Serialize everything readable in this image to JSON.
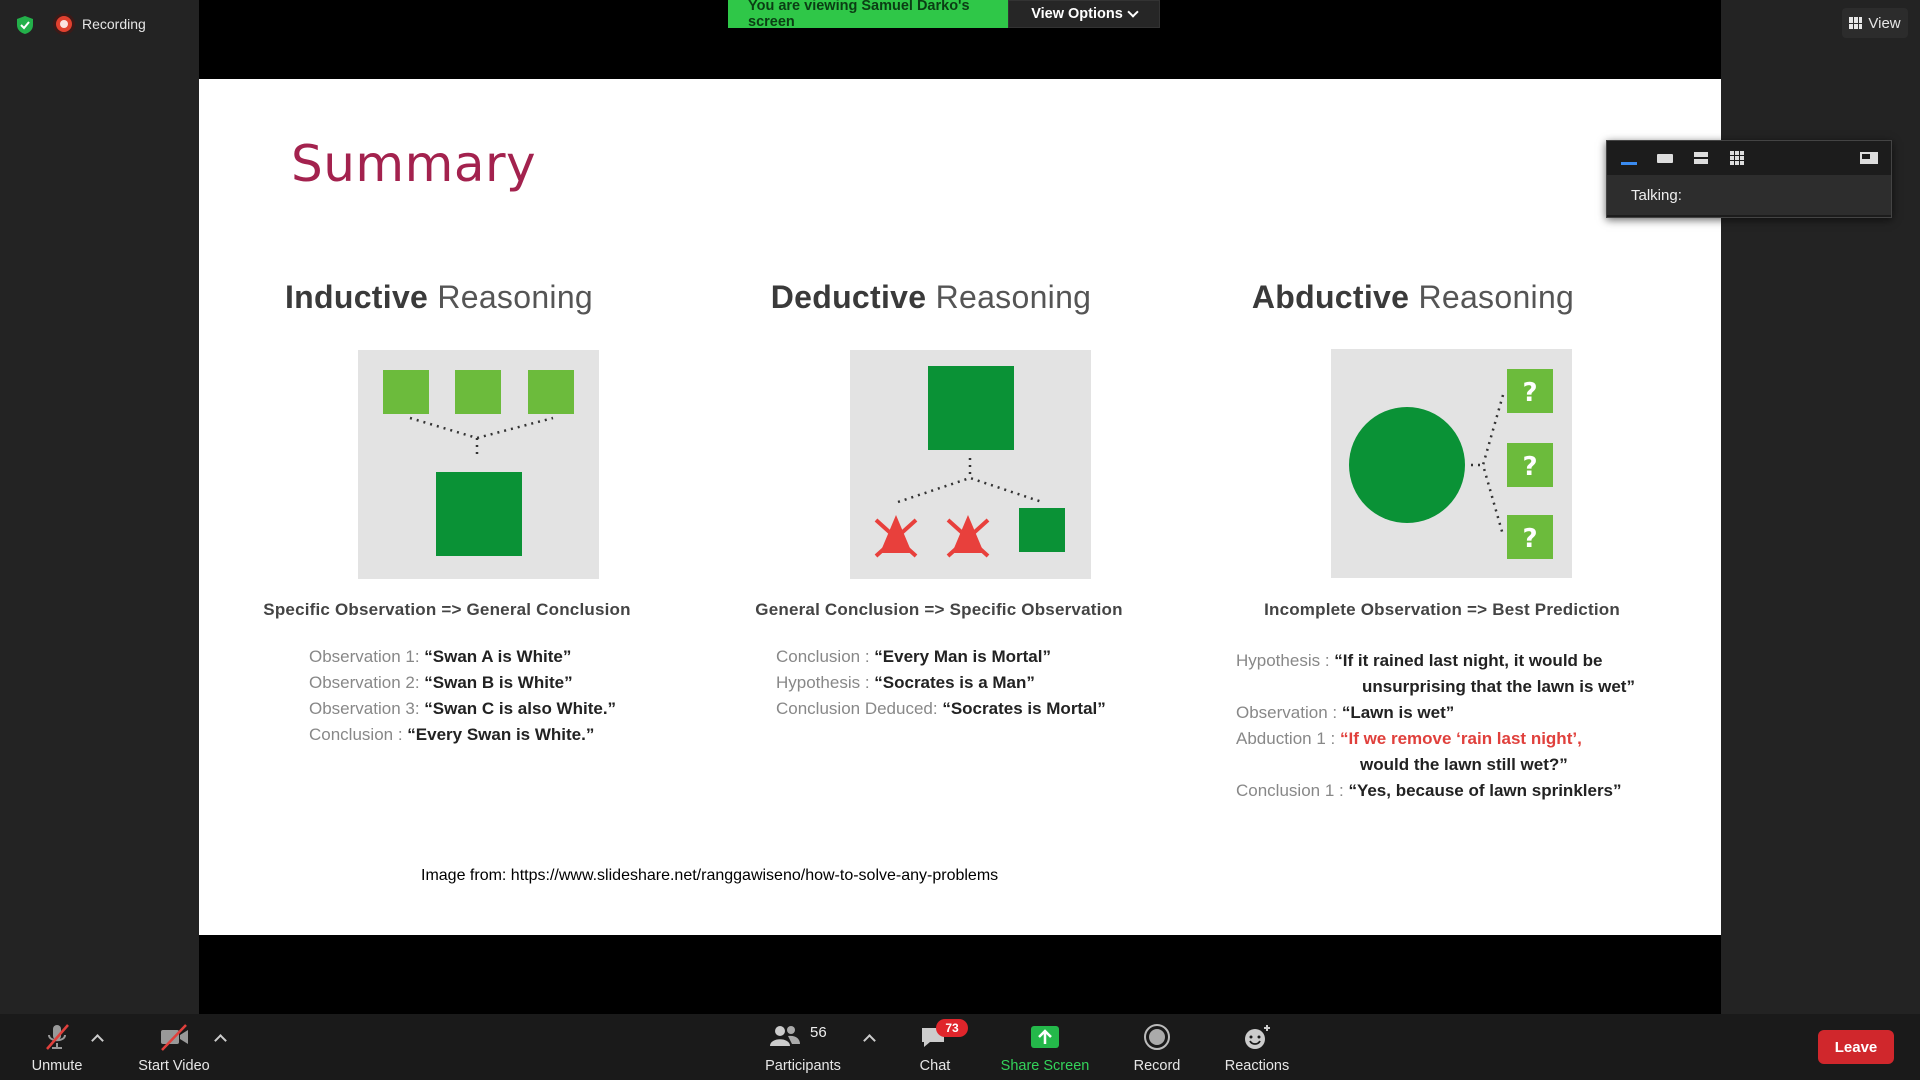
{
  "meeting": {
    "recording_label": "Recording",
    "view_label": "View",
    "banner_text": "You are viewing Samuel Darko's screen",
    "view_options_label": "View Options",
    "talking_label": "Talking:"
  },
  "slide": {
    "title": "Summary",
    "credit": "Image from: https://www.slideshare.net/ranggawiseno/how-to-solve-any-problems",
    "columns": [
      {
        "title_bold": "Inductive",
        "title_rest": " Reasoning",
        "caption": "Specific Observation => General Conclusion",
        "lines": [
          {
            "label": "Observation 1: ",
            "value": "“Swan A is White”"
          },
          {
            "label": "Observation 2: ",
            "value": "“Swan B is White”"
          },
          {
            "label": "Observation 3: ",
            "value": "“Swan C is also White.”"
          },
          {
            "label": "Conclusion      : ",
            "value": "“Every Swan is White.”"
          }
        ]
      },
      {
        "title_bold": "Deductive",
        "title_rest": " Reasoning",
        "caption": "General Conclusion => Specific Observation",
        "lines": [
          {
            "label": "Conclusion               : ",
            "value": "“Every Man is Mortal”"
          },
          {
            "label": "Hypothesis               : ",
            "value": "“Socrates is a Man”"
          },
          {
            "label": "Conclusion Deduced: ",
            "value": "“Socrates is Mortal”"
          }
        ]
      },
      {
        "title_bold": "Abductive",
        "title_rest": " Reasoning",
        "caption": "Incomplete Observation => Best Prediction",
        "lines": [
          {
            "label": "Hypothesis    : ",
            "value": "“If it rained last night, it would be"
          },
          {
            "label": "",
            "value": "unsurprising that the lawn is wet”"
          },
          {
            "label": "Observation  : ",
            "value": "“Lawn is wet”"
          },
          {
            "label": "Abduction  1 : ",
            "value_red": "“If we remove ‘rain last night’,"
          },
          {
            "label": "",
            "value": "would the lawn still wet?”"
          },
          {
            "label": "Conclusion 1 : ",
            "value": "“Yes, because of lawn sprinklers”"
          }
        ]
      }
    ]
  },
  "toolbar": {
    "unmute": "Unmute",
    "start_video": "Start Video",
    "participants": "Participants",
    "participants_count": "56",
    "chat": "Chat",
    "chat_badge": "73",
    "share_screen": "Share Screen",
    "record": "Record",
    "reactions": "Reactions",
    "leave": "Leave"
  },
  "colors": {
    "green_light": "#6cbb3c",
    "green_dark": "#0a9236",
    "title_red": "#a3224e",
    "share_green": "#2fc748",
    "leave_red": "#d0272c"
  }
}
